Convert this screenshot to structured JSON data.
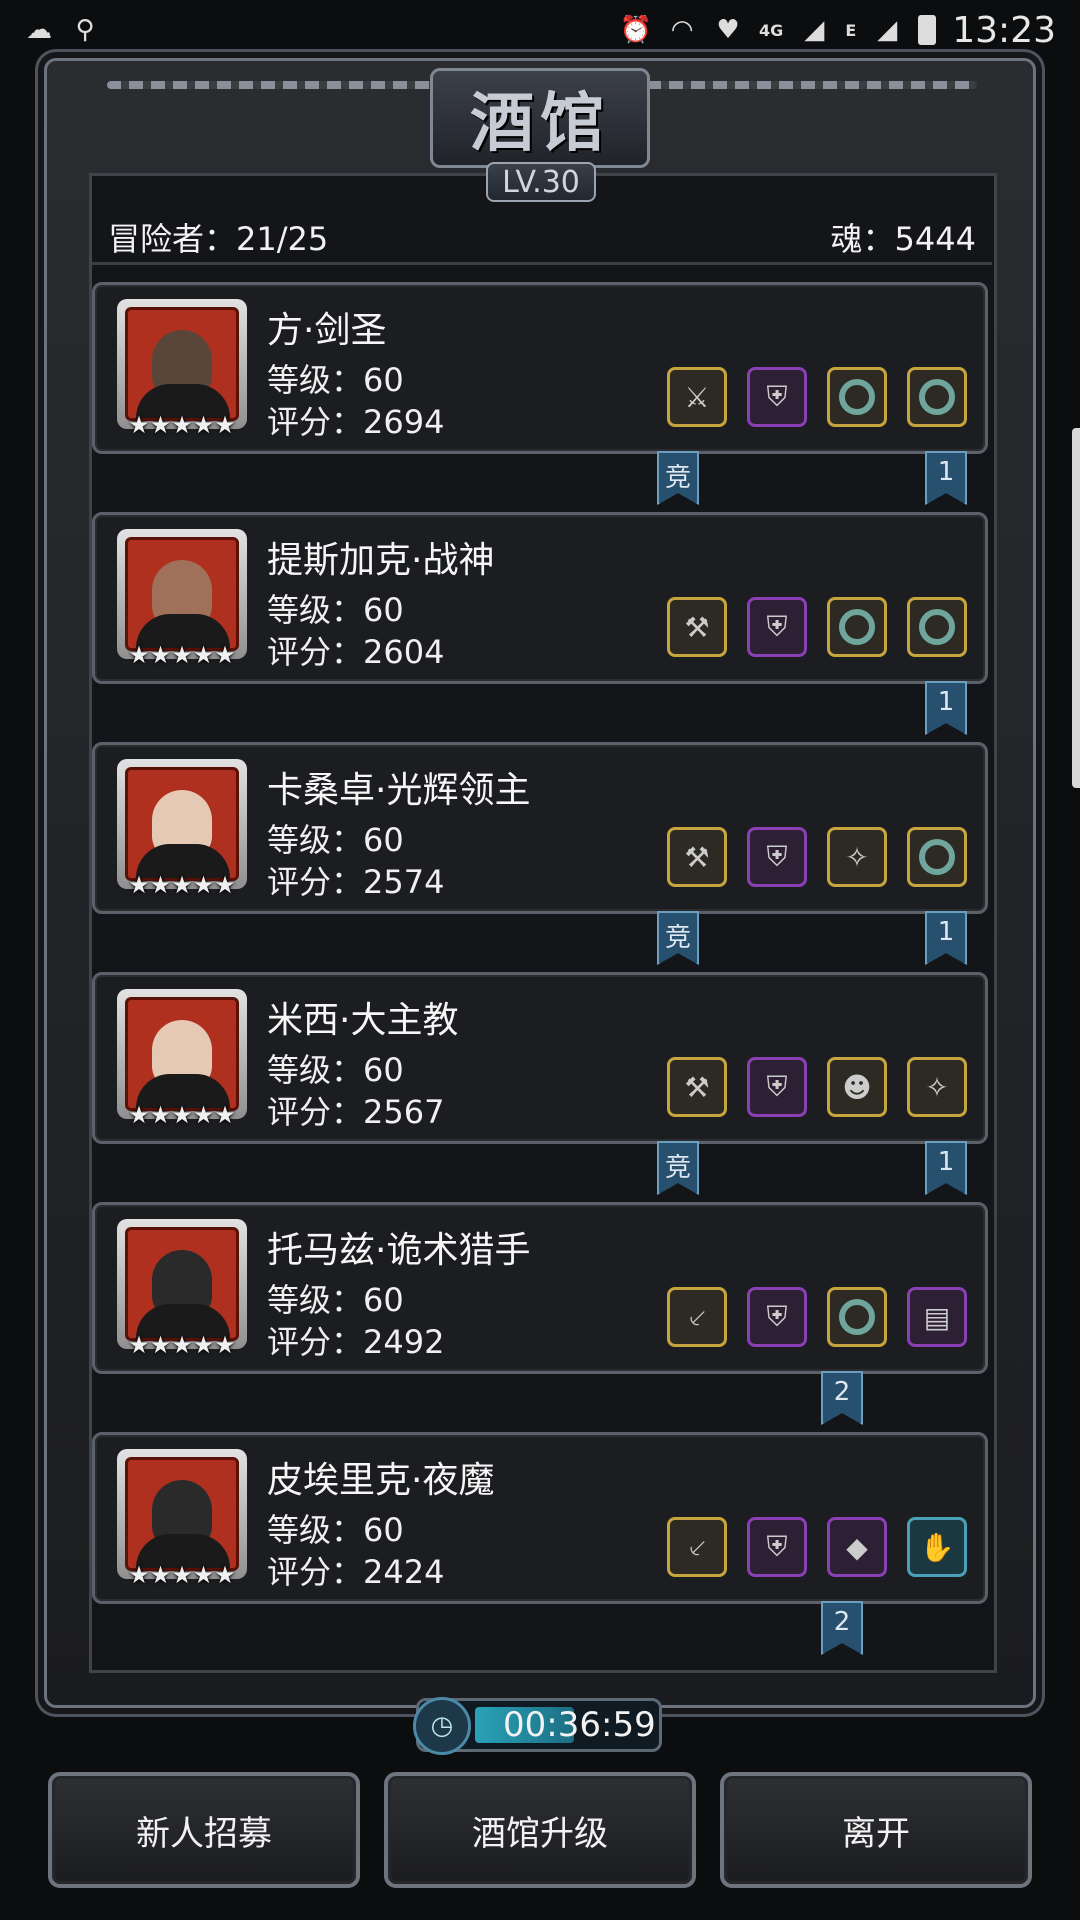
{
  "status_bar": {
    "time": "13:23",
    "network_4g": "4G",
    "network_e": "E"
  },
  "header": {
    "title": "酒馆",
    "level": "LV.30"
  },
  "info": {
    "adventurers": "冒险者：21/25",
    "soul": "魂：5444"
  },
  "heroes": [
    {
      "name": "方·剑圣",
      "level": "等级：60",
      "score": "评分：2694",
      "stars": "★★★★★",
      "ribbon_left": "竞",
      "ribbon_right": "1",
      "equipment": [
        "sword-icon",
        "armor-icon",
        "ring-icon",
        "ring-icon"
      ]
    },
    {
      "name": "提斯加克·战神",
      "level": "等级：60",
      "score": "评分：2604",
      "stars": "★★★★★",
      "ribbon_left": "",
      "ribbon_right": "1",
      "equipment": [
        "axe-icon",
        "armor-icon",
        "ring-icon",
        "ring-icon"
      ]
    },
    {
      "name": "卡桑卓·光辉领主",
      "level": "等级：60",
      "score": "评分：2574",
      "stars": "★★★★★",
      "ribbon_left": "竞",
      "ribbon_right": "1",
      "equipment": [
        "hammer-icon",
        "armor-icon",
        "amulet-icon",
        "ring-icon"
      ]
    },
    {
      "name": "米西·大主教",
      "level": "等级：60",
      "score": "评分：2567",
      "stars": "★★★★★",
      "ribbon_left": "竞",
      "ribbon_right": "1",
      "equipment": [
        "hammer-icon",
        "armor-icon",
        "mask-icon",
        "amulet-icon"
      ]
    },
    {
      "name": "托马兹·诡术猎手",
      "level": "等级：60",
      "score": "评分：2492",
      "stars": "★★★★★",
      "ribbon_left": "",
      "ribbon_right": "2",
      "equipment": [
        "dagger-icon",
        "armor-icon",
        "ring-icon",
        "scroll-icon"
      ]
    },
    {
      "name": "皮埃里克·夜魔",
      "level": "等级：60",
      "score": "评分：2424",
      "stars": "★★★★★",
      "ribbon_left": "",
      "ribbon_right": "2",
      "equipment": [
        "dagger-icon",
        "armor-icon",
        "ruby-icon",
        "gauntlet-icon"
      ]
    }
  ],
  "timer": {
    "text": "00:36:59",
    "progress": 0.55
  },
  "buttons": {
    "recruit": "新人招募",
    "upgrade": "酒馆升级",
    "leave": "离开"
  }
}
